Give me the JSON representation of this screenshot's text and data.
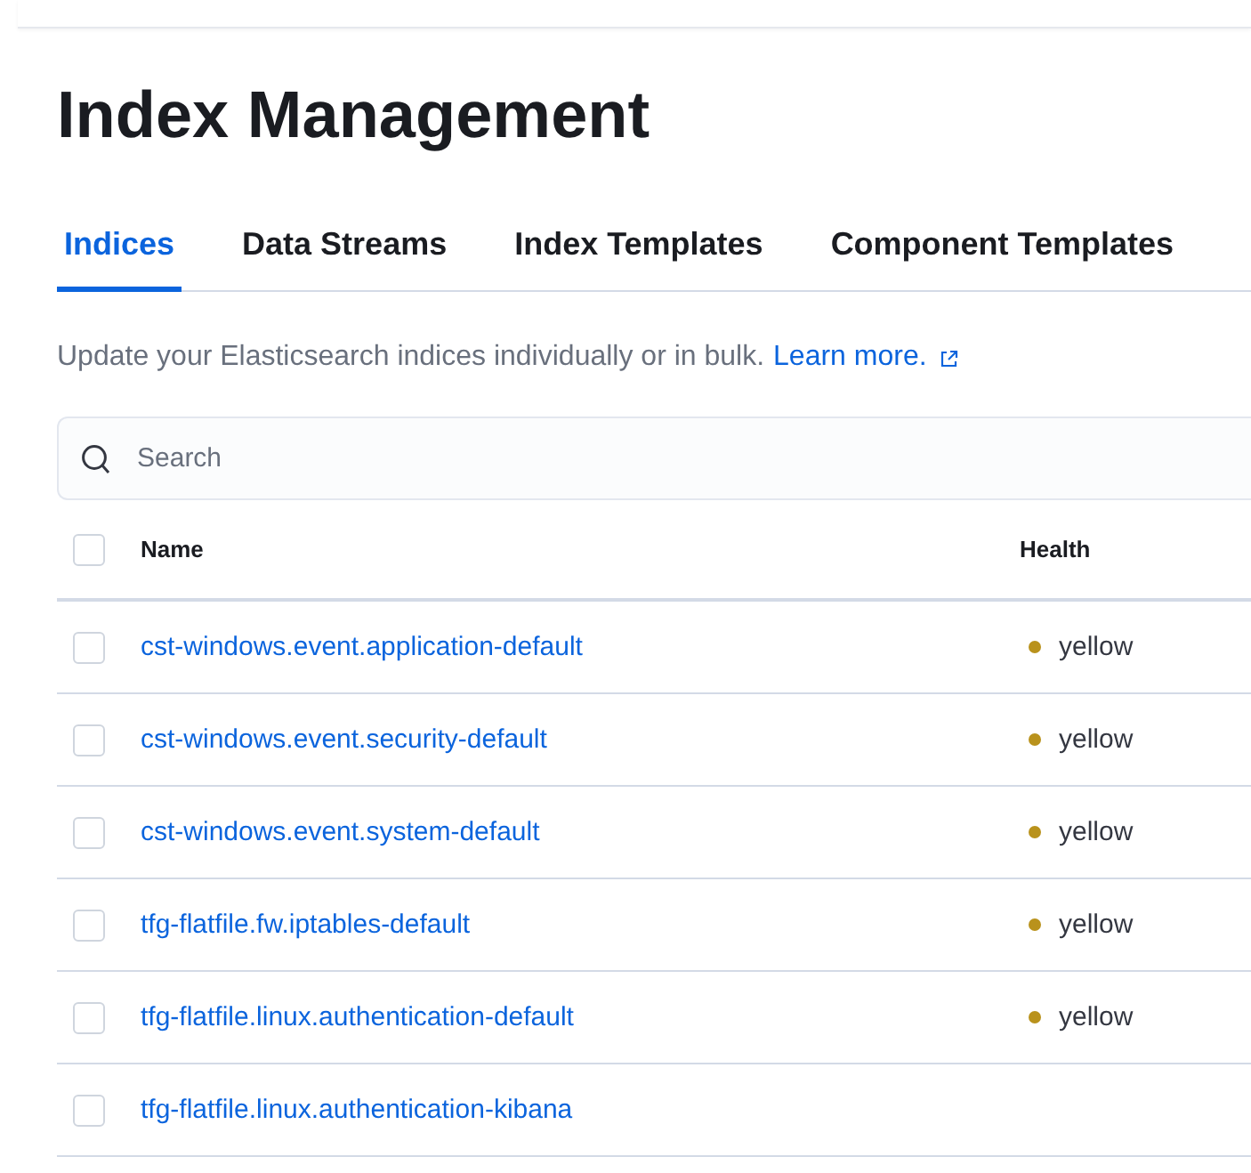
{
  "title": "Index Management",
  "tabs": [
    {
      "label": "Indices",
      "selected": true
    },
    {
      "label": "Data Streams",
      "selected": false
    },
    {
      "label": "Index Templates",
      "selected": false
    },
    {
      "label": "Component Templates",
      "selected": false
    }
  ],
  "description": {
    "text": "Update your Elasticsearch indices individually or in bulk.",
    "link": "Learn more."
  },
  "search": {
    "placeholder": "Search"
  },
  "table": {
    "columns": [
      "Name",
      "Health"
    ],
    "header_checked": false,
    "rows": [
      {
        "name": "cst-windows.event.application-default",
        "health": "yellow",
        "color": "#b9921c",
        "checked": false
      },
      {
        "name": "cst-windows.event.security-default",
        "health": "yellow",
        "color": "#b9921c",
        "checked": false
      },
      {
        "name": "cst-windows.event.system-default",
        "health": "yellow",
        "color": "#b9921c",
        "checked": false
      },
      {
        "name": "tfg-flatfile.fw.iptables-default",
        "health": "yellow",
        "color": "#b9921c",
        "checked": false
      },
      {
        "name": "tfg-flatfile.linux.authentication-default",
        "health": "yellow",
        "color": "#b9921c",
        "checked": false
      },
      {
        "name": "tfg-flatfile.linux.authentication-kibana",
        "checked": false
      }
    ]
  }
}
